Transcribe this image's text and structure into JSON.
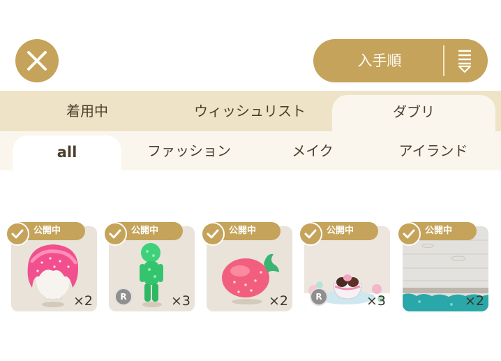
{
  "header": {
    "close_icon": "close-icon",
    "sort_label": "入手順",
    "sort_icon": "sort-icon",
    "accent_color": "#c5a35a"
  },
  "tabs_primary": [
    {
      "label": "着用中",
      "active": false
    },
    {
      "label": "ウィッシュリスト",
      "active": false
    },
    {
      "label": "ダブリ",
      "active": true
    }
  ],
  "tabs_secondary": [
    {
      "label": "all",
      "active": true
    },
    {
      "label": "ファッション",
      "active": false
    },
    {
      "label": "メイク",
      "active": false
    },
    {
      "label": "アイランド",
      "active": false
    }
  ],
  "items": [
    {
      "badge": "公開中",
      "count": "×2",
      "rarity": "",
      "name": "strawberry-hair"
    },
    {
      "badge": "公開中",
      "count": "×3",
      "rarity": "R",
      "name": "green-figure"
    },
    {
      "badge": "公開中",
      "count": "×2",
      "rarity": "",
      "name": "strawberry"
    },
    {
      "badge": "公開中",
      "count": "×3",
      "rarity": "R",
      "name": "sweets-table"
    },
    {
      "badge": "公開中",
      "count": "×2",
      "rarity": "",
      "name": "wood-floor"
    }
  ]
}
